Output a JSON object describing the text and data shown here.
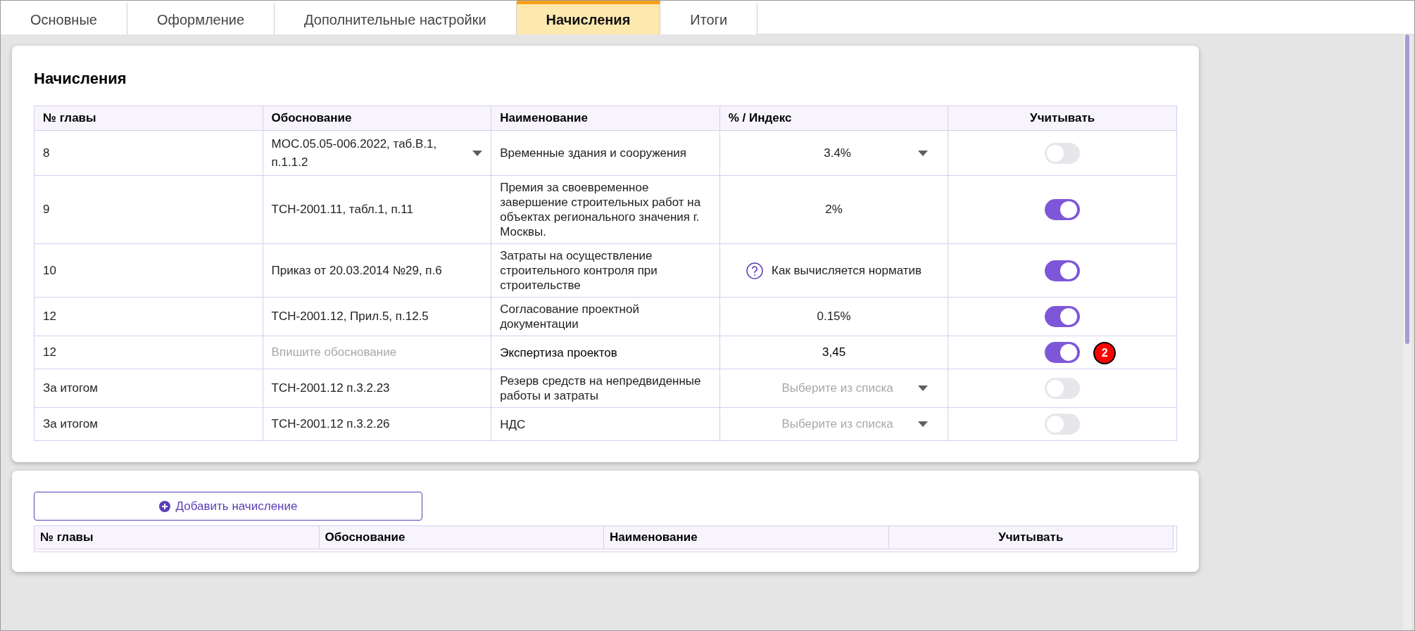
{
  "tabs": [
    {
      "label": "Основные",
      "selected": false
    },
    {
      "label": "Оформление",
      "selected": false
    },
    {
      "label": "Дополнительные настройки",
      "selected": false
    },
    {
      "label": "Начисления",
      "selected": true
    },
    {
      "label": "Итоги",
      "selected": false
    }
  ],
  "accruals": {
    "title": "Начисления",
    "columns": [
      "№ главы",
      "Обоснование",
      "Наименование",
      "% / Индекс",
      "Учитывать"
    ],
    "rows": [
      {
        "chapter": "8",
        "basis": {
          "kind": "select",
          "text": "МОС.05.05-006.2022, таб.В.1, п.1.1.2"
        },
        "name": {
          "kind": "text",
          "text": "Временные здания и сооружения"
        },
        "percent": {
          "kind": "select",
          "text": "3.4%"
        },
        "include": {
          "on": false
        }
      },
      {
        "chapter": "9",
        "basis": {
          "kind": "text",
          "text": "ТСН-2001.11, табл.1, п.11"
        },
        "name": {
          "kind": "text",
          "text": "Премия за своевременное завершение строительных работ на объектах регионального значения г. Москвы."
        },
        "percent": {
          "kind": "text",
          "text": "2%"
        },
        "include": {
          "on": true
        }
      },
      {
        "chapter": "10",
        "basis": {
          "kind": "text",
          "text": "Приказ от 20.03.2014 №29, п.6"
        },
        "name": {
          "kind": "text",
          "text": "Затраты на осуществление строительного контроля при строительстве"
        },
        "percent": {
          "kind": "help",
          "text": "Как вычисляется норматив"
        },
        "include": {
          "on": true
        }
      },
      {
        "chapter": "12",
        "basis": {
          "kind": "text",
          "text": "ТСН-2001.12, Прил.5, п.12.5"
        },
        "name": {
          "kind": "text",
          "text": "Согласование проектной документации"
        },
        "percent": {
          "kind": "text",
          "text": "0.15%"
        },
        "include": {
          "on": true
        }
      },
      {
        "chapter": "12",
        "basis": {
          "kind": "input",
          "placeholder": "Впишите обоснование"
        },
        "name": {
          "kind": "input",
          "text": "Экспертиза проектов"
        },
        "percent": {
          "kind": "input",
          "text": "3,45"
        },
        "include": {
          "on": true
        },
        "badge": "2"
      },
      {
        "chapter": "За итогом",
        "basis": {
          "kind": "text",
          "text": "ТСН-2001.12 п.3.2.23"
        },
        "name": {
          "kind": "text",
          "text": "Резерв средств на непредвиденные работы и затраты"
        },
        "percent": {
          "kind": "select",
          "placeholder": "Выберите из списка"
        },
        "include": {
          "on": false
        }
      },
      {
        "chapter": "За итогом",
        "basis": {
          "kind": "text",
          "text": "ТСН-2001.12 п.3.2.26"
        },
        "name": {
          "kind": "text",
          "text": "НДС"
        },
        "percent": {
          "kind": "select",
          "placeholder": "Выберите из списка"
        },
        "include": {
          "on": false
        }
      }
    ]
  },
  "custom": {
    "add_button": "Добавить начисление",
    "columns": [
      "№ главы",
      "Обоснование",
      "Наименование",
      "Учитывать"
    ]
  }
}
